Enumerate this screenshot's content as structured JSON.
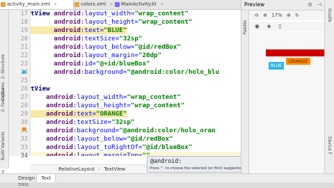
{
  "tabs": [
    {
      "label": "activity_main.xml",
      "color": "#e8a33d"
    },
    {
      "label": "colors.xml",
      "color": "#e8a33d"
    },
    {
      "label": "MainActivity.kt",
      "color": "#7f6df2"
    }
  ],
  "tab_close": "×",
  "left_labels": {
    "structure": "2: Structure",
    "captures": "Captures",
    "favorites": "2: Favorites",
    "build_variants": "Build Variants",
    "captures_short": "aptures"
  },
  "gutter": {
    "line_numbers": [
      "17",
      "18",
      "19",
      "20",
      "21",
      "22",
      "23",
      "24",
      "25",
      "26",
      "27",
      "28",
      "29",
      "30",
      "31",
      "32",
      "33",
      "34"
    ]
  },
  "code_lines": [
    [
      {
        "t": "tView ",
        "c": "tg"
      },
      {
        "t": "android",
        "c": "ns"
      },
      {
        "t": ":layout_width=",
        "c": "at"
      },
      {
        "t": "\"wrap_content\"",
        "c": "val"
      }
    ],
    [
      {
        "t": "      android",
        "c": "ns"
      },
      {
        "t": ":layout_height=",
        "c": "at"
      },
      {
        "t": "\"wrap_content\"",
        "c": "val"
      }
    ],
    [
      {
        "t": "      android",
        "c": "ns",
        "hl": true
      },
      {
        "t": ":text=",
        "c": "at",
        "hl": true
      },
      {
        "t": "\"BLUE\"",
        "c": "val",
        "hl": true
      }
    ],
    [
      {
        "t": "      android",
        "c": "ns"
      },
      {
        "t": ":textSize=",
        "c": "at"
      },
      {
        "t": "\"32sp\"",
        "c": "val"
      }
    ],
    [
      {
        "t": "      android",
        "c": "ns"
      },
      {
        "t": ":layout_below=",
        "c": "at"
      },
      {
        "t": "\"@id/redBox\"",
        "c": "val"
      }
    ],
    [
      {
        "t": "      android",
        "c": "ns"
      },
      {
        "t": ":layout_margin=",
        "c": "at"
      },
      {
        "t": "\"20dp\"",
        "c": "val"
      }
    ],
    [
      {
        "t": "      android",
        "c": "ns"
      },
      {
        "t": ":id=",
        "c": "at"
      },
      {
        "t": "\"@+id/blueBox\"",
        "c": "val"
      }
    ],
    [
      {
        "t": "      android",
        "c": "ns"
      },
      {
        "t": ":background=",
        "c": "at"
      },
      {
        "t": "\"@android:color/holo_blu",
        "c": "val"
      }
    ],
    [
      {
        "t": "",
        "c": "at"
      }
    ],
    [
      {
        "t": "tView",
        "c": "tg"
      }
    ],
    [
      {
        "t": "    android",
        "c": "ns"
      },
      {
        "t": ":layout_width=",
        "c": "at"
      },
      {
        "t": "\"wrap_content\"",
        "c": "val"
      }
    ],
    [
      {
        "t": "    android",
        "c": "ns"
      },
      {
        "t": ":layout_height=",
        "c": "at"
      },
      {
        "t": "\"wrap_content\"",
        "c": "val"
      }
    ],
    [
      {
        "t": "    android",
        "c": "ns",
        "hl": true
      },
      {
        "t": ":text=",
        "c": "at",
        "hl": true
      },
      {
        "t": "\"ORANGE\"",
        "c": "val",
        "hl": true
      }
    ],
    [
      {
        "t": "    android",
        "c": "ns"
      },
      {
        "t": ":textSize=",
        "c": "at"
      },
      {
        "t": "\"32sp\"",
        "c": "val"
      }
    ],
    [
      {
        "t": "    android",
        "c": "ns"
      },
      {
        "t": ":background=",
        "c": "at"
      },
      {
        "t": "\"@android:color/holo_oran",
        "c": "val"
      }
    ],
    [
      {
        "t": "    android",
        "c": "ns"
      },
      {
        "t": ":layout_below=",
        "c": "at"
      },
      {
        "t": "\"@id/redBox\"",
        "c": "val"
      }
    ],
    [
      {
        "t": "    android",
        "c": "ns"
      },
      {
        "t": ":layout_toRightOf=",
        "c": "at"
      },
      {
        "t": "\"@id/blueBox\"",
        "c": "val"
      }
    ],
    [
      {
        "t": "    android",
        "c": "ns"
      },
      {
        "t": ":layout_marginTop=",
        "c": "at"
      },
      {
        "t": "\"\"",
        "c": "val"
      }
    ]
  ],
  "current_line_index": 17,
  "breadcrumb": {
    "parent": "RelativeLayout",
    "sep": "›",
    "child": "TextView"
  },
  "autocomplete": {
    "item": "@android:",
    "hint": "Press ^. to choose the selected (or first) suggestion and insert a dot afterwards",
    "link": ">>"
  },
  "bottom_tabs": {
    "design": "Design",
    "text": "Text"
  },
  "preview": {
    "title": "Preview",
    "zoom": "17%",
    "palette_label": "Palette",
    "red_label": "",
    "blue_label": "BLUE",
    "orange_label": "ORANGE",
    "colors": {
      "red": "#cc0000",
      "blue": "#33b5e5",
      "orange": "#ff8800"
    }
  },
  "right_labels": {
    "gradle": "Gradle",
    "device": "Device F"
  },
  "status": {
    "left": "TODO",
    "right": ""
  }
}
